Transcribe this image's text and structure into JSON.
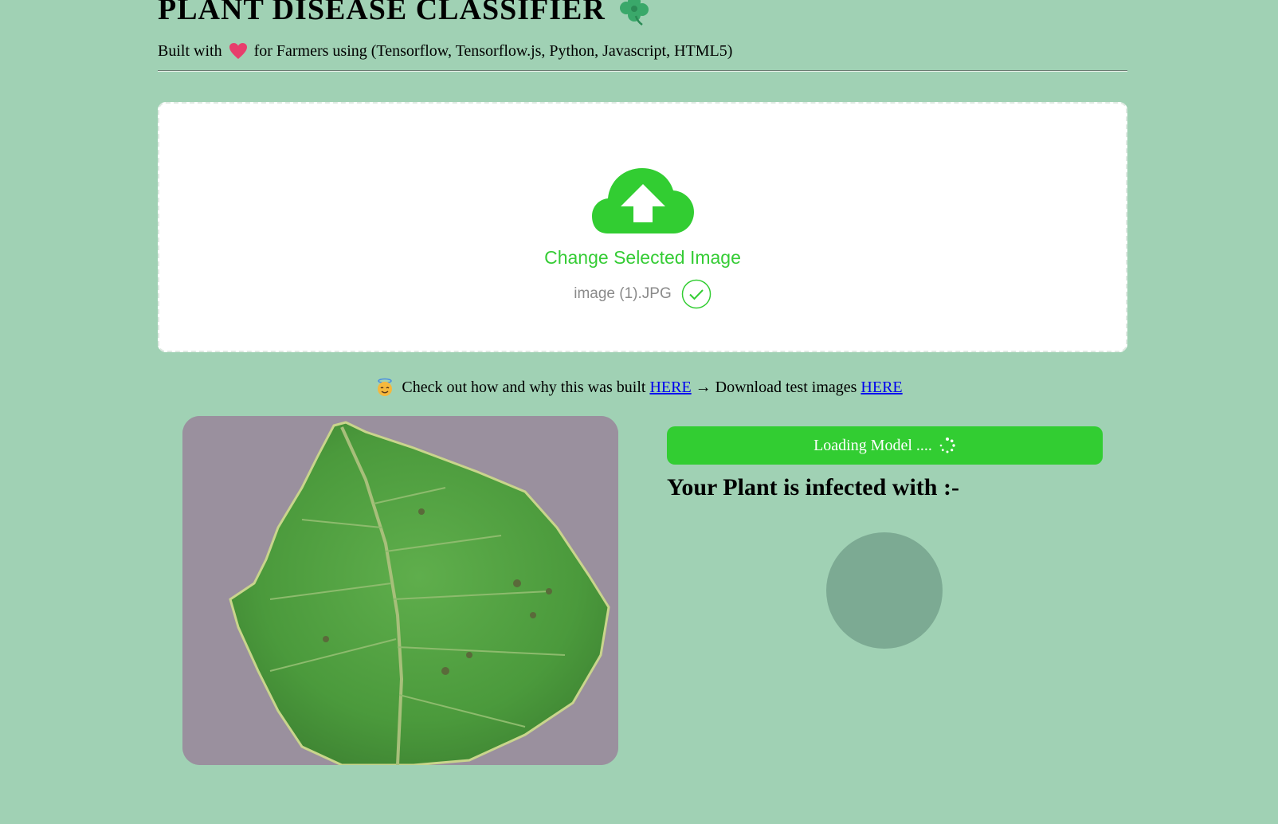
{
  "header": {
    "title": "PLANT DISEASE CLASSIFIER",
    "subtitle_prefix": "Built with",
    "subtitle_suffix": "for Farmers using (Tensorflow, Tensorflow.js, Python, Javascript, HTML5)"
  },
  "upload": {
    "change_label": "Change Selected Image",
    "file_name": "image (1).JPG",
    "icon": "cloud-upload-icon",
    "accent_color": "#32cd32"
  },
  "info": {
    "text_1": "Check out how and why this was built",
    "link_1": "HERE",
    "arrow": "→",
    "text_2": "Download test images",
    "link_2": "HERE"
  },
  "result": {
    "button_label": "Loading Model ....",
    "heading": "Your Plant is infected with :-"
  },
  "colors": {
    "background": "#a0d1b4",
    "button": "#32cd32",
    "result_circle": "#7caa93"
  }
}
